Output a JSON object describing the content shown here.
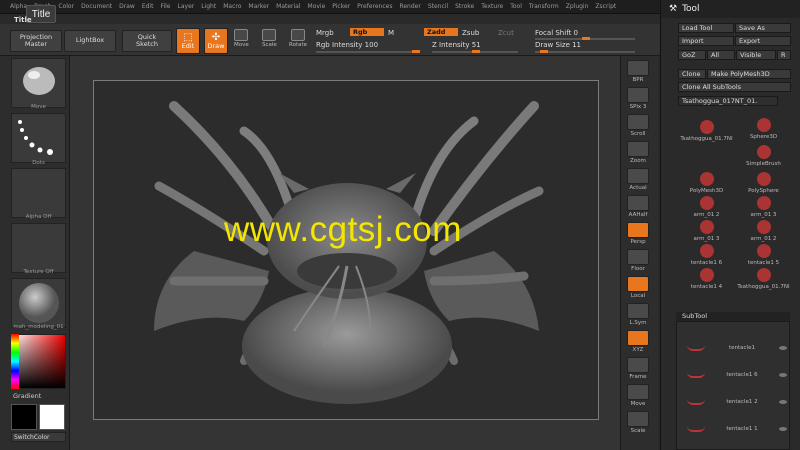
{
  "menu": [
    "Alpha",
    "Brush",
    "Color",
    "Document",
    "Draw",
    "Edit",
    "File",
    "Layer",
    "Light",
    "Macro",
    "Marker",
    "Material",
    "Movie",
    "Picker",
    "Preferences",
    "Render",
    "Stencil",
    "Stroke",
    "Texture",
    "Tool",
    "Transform",
    "Zplugin",
    "Zscript"
  ],
  "title_tab": "Title",
  "title_small": "Title",
  "toolbar": {
    "projection_master": "Projection\nMaster",
    "lightbox": "LightBox",
    "quick_sketch": "Quick\nSketch",
    "edit": "Edit",
    "draw": "Draw",
    "move": "Move",
    "scale": "Scale",
    "rotate": "Rotate",
    "mrgb": "Mrgb",
    "rgb": "Rgb",
    "m": "M",
    "rgb_intensity": "Rgb Intensity 100",
    "zadd": "Zadd",
    "zsub": "Zsub",
    "zcut": "Zcut",
    "z_intensity": "Z Intensity 51",
    "focal_shift": "Focal Shift 0",
    "draw_size": "Draw Size 11"
  },
  "left": {
    "move": "Move",
    "dots": "Dots",
    "alpha_off": "Alpha Off",
    "texture_off": "Texture Off",
    "material": "mah_modeling_01",
    "gradient": "Gradient",
    "switch_color": "SwitchColor"
  },
  "watermark": "www.cgtsj.com",
  "right_strip": [
    "BPR",
    "SPix 3",
    "Scroll",
    "Zoom",
    "Actual",
    "AAHalf",
    "Persp",
    "Floor",
    "Local",
    "L.Sym",
    "XYZ",
    "Frame",
    "Move",
    "Scale"
  ],
  "tool": {
    "title": "Tool",
    "load_tool": "Load Tool",
    "save_as": "Save As",
    "import": "Import",
    "export": "Export",
    "goz": "GoZ",
    "all": "All",
    "visible": "Visible",
    "r": "R",
    "clone": "Clone",
    "make_polymesh": "Make PolyMesh3D",
    "clone_all": "Clone All SubTools",
    "current_tool": "Tsathoggua_017NT_01.",
    "tools": [
      "Tsathoggua_01.7NI",
      "Sphere3D",
      "SimpleBrush",
      "PolyMesh3D",
      "PolySphere",
      "arm_01 2",
      "arm_01 3",
      "arm_01 3",
      "arm_01 2",
      "tentacle1 6",
      "tentacle1 5",
      "tentacle1 4",
      "Tsathoggua_01.7NI"
    ],
    "subtool_title": "SubTool",
    "subtools": [
      "tentacle1",
      "tentacle1 6",
      "tentacle1 2",
      "tentacle1 1"
    ]
  },
  "colors": {
    "accent": "#e8761e",
    "watermark": "#f3e600"
  }
}
